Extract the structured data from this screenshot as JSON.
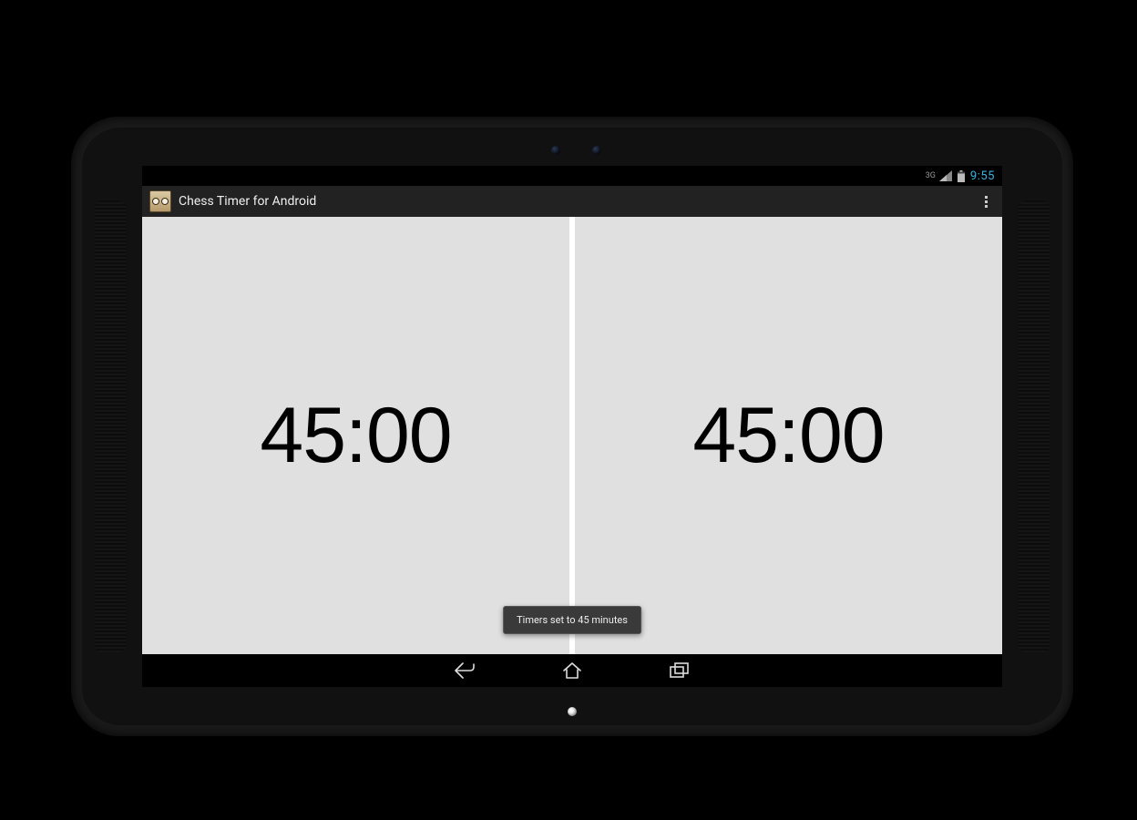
{
  "status_bar": {
    "network_label": "3G",
    "clock": "9:55"
  },
  "action_bar": {
    "title": "Chess Timer for Android",
    "icon_name": "chess-clock-icon",
    "overflow_name": "overflow-menu"
  },
  "timers": {
    "left": "45:00",
    "right": "45:00"
  },
  "toast": {
    "message": "Timers set to 45 minutes"
  },
  "nav": {
    "back": "back",
    "home": "home",
    "recent": "recent"
  },
  "colors": {
    "accent": "#33b5e5",
    "pane_bg": "#e0e0e0",
    "action_bar_bg": "#222222"
  }
}
